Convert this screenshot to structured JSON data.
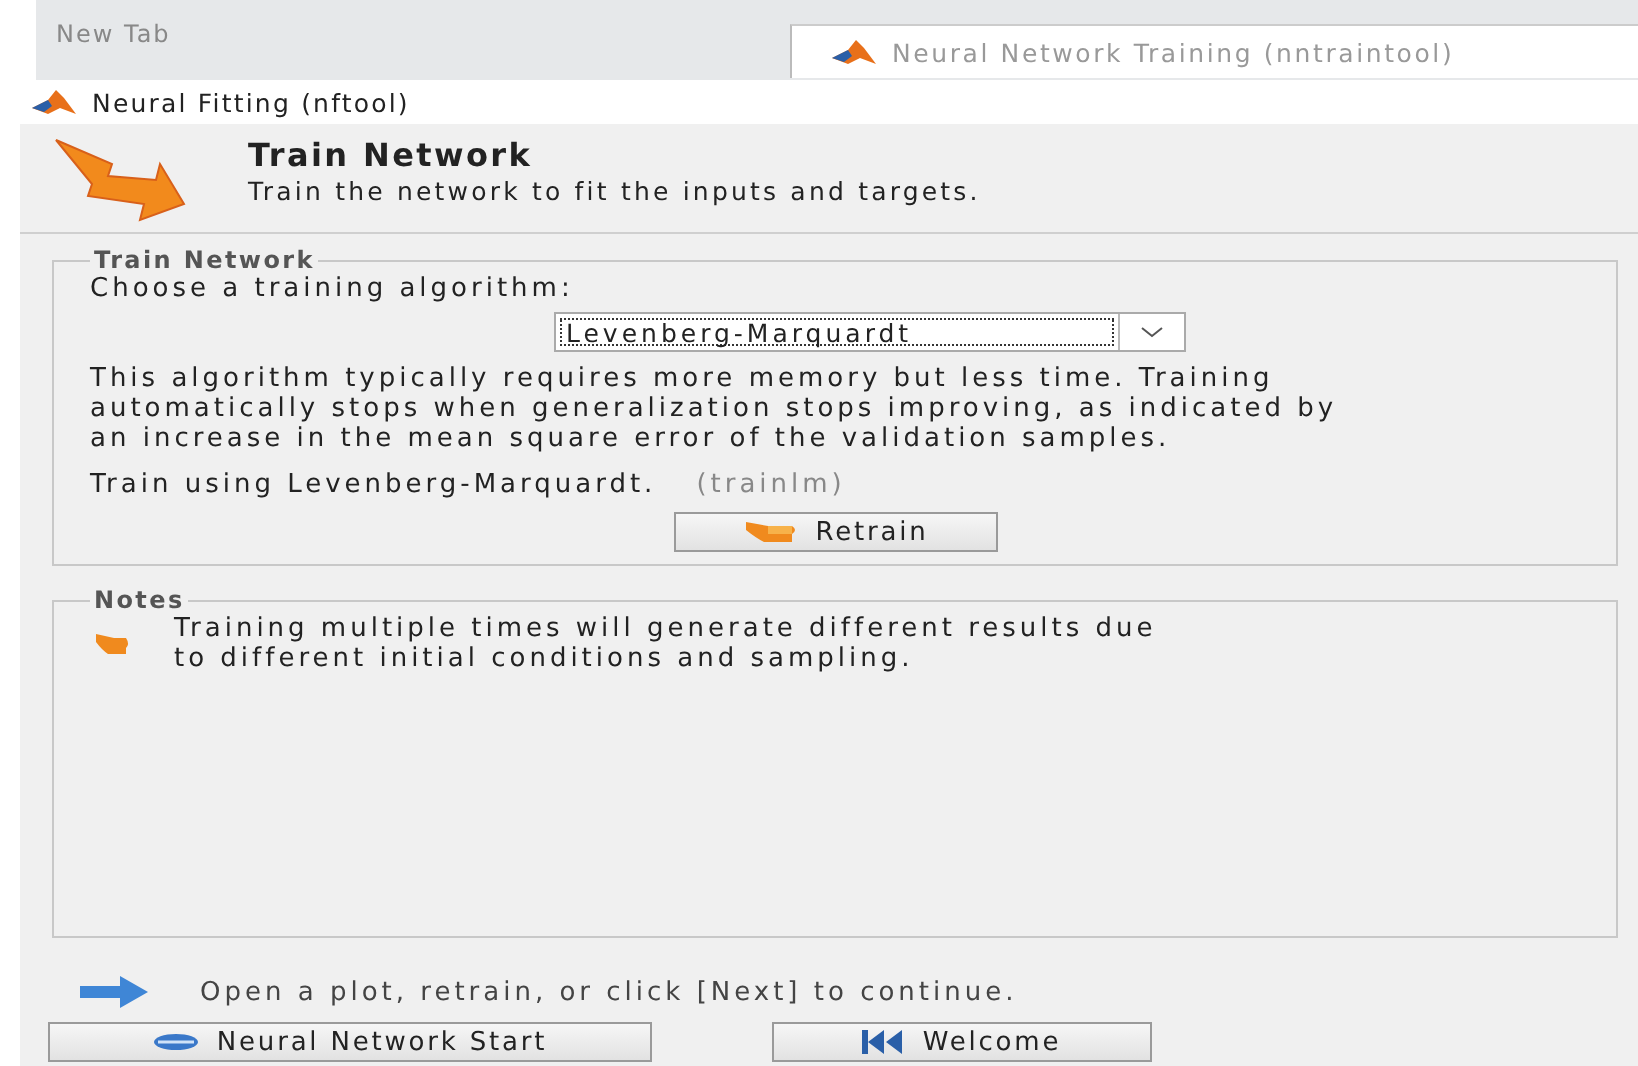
{
  "tabs": [
    {
      "label": "New Tab",
      "selected": false
    }
  ],
  "overlay_window": {
    "title": "Neural Network Training (nntraintool)"
  },
  "window": {
    "title": "Neural Fitting (nftool)"
  },
  "header": {
    "title": "Train Network",
    "subtitle": "Train the network to fit the inputs and targets."
  },
  "train_group": {
    "legend": "Train Network",
    "prompt": "Choose a training algorithm:",
    "algorithm": {
      "value": "Levenberg-Marquardt"
    },
    "description": "This algorithm typically requires more memory but less time. Training\nautomatically stops when generalization stops improving, as indicated by\nan increase in the mean square error of the validation samples.",
    "using": "Train using Levenberg-Marquardt.",
    "function": "(trainlm)",
    "retrain_button": "Retrain"
  },
  "notes": {
    "legend": "Notes",
    "text": "Training multiple times will generate different results due\nto different initial conditions and sampling."
  },
  "hint": "Open a plot, retrain, or click [Next] to continue.",
  "buttons": [
    {
      "label": "Neural Network Start",
      "kind": "start"
    },
    {
      "label": "Welcome",
      "kind": "welcome"
    }
  ]
}
